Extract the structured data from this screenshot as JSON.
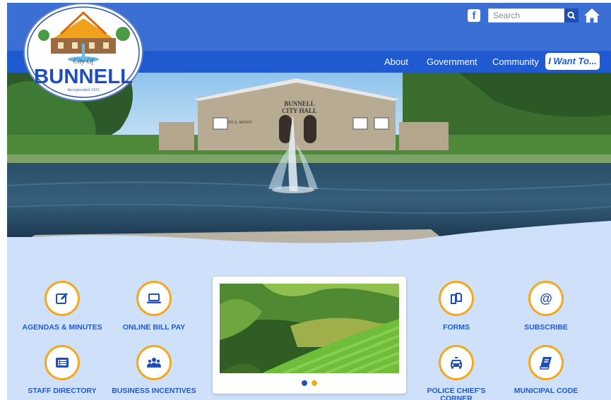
{
  "header": {
    "logo_text": "BUNNELL",
    "logo_script": "City Of",
    "logo_sub": "Incorporated 1913",
    "search_placeholder": "Search"
  },
  "nav": {
    "items": [
      {
        "label": "About"
      },
      {
        "label": "Government"
      },
      {
        "label": "Community"
      }
    ],
    "cta_label": "I Want To..."
  },
  "hero": {
    "sign_line1": "BUNNELL",
    "sign_line2": "CITY HALL",
    "address": "201 E. MOODY"
  },
  "quicklinks": [
    {
      "label": "AGENDAS & MINUTES",
      "icon": "edit-icon"
    },
    {
      "label": "ONLINE BILL PAY",
      "icon": "laptop-icon"
    },
    {
      "label": "STAFF DIRECTORY",
      "icon": "list-icon"
    },
    {
      "label": "BUSINESS INCENTIVES",
      "icon": "users-icon"
    },
    {
      "label": "FORMS",
      "icon": "documents-icon"
    },
    {
      "label": "SUBSCRIBE",
      "icon": "at-icon"
    },
    {
      "label": "POLICE CHIEF'S CORNER",
      "icon": "car-icon"
    },
    {
      "label": "MUNICIPAL CODE",
      "icon": "book-icon"
    }
  ],
  "slider": {
    "active_index": 0,
    "slide_count": 2
  },
  "colors": {
    "top_bar": "#3b6fd4",
    "nav_bar": "#1f5ad1",
    "accent": "#f4a81d",
    "body_bg": "#cfe0fb"
  }
}
